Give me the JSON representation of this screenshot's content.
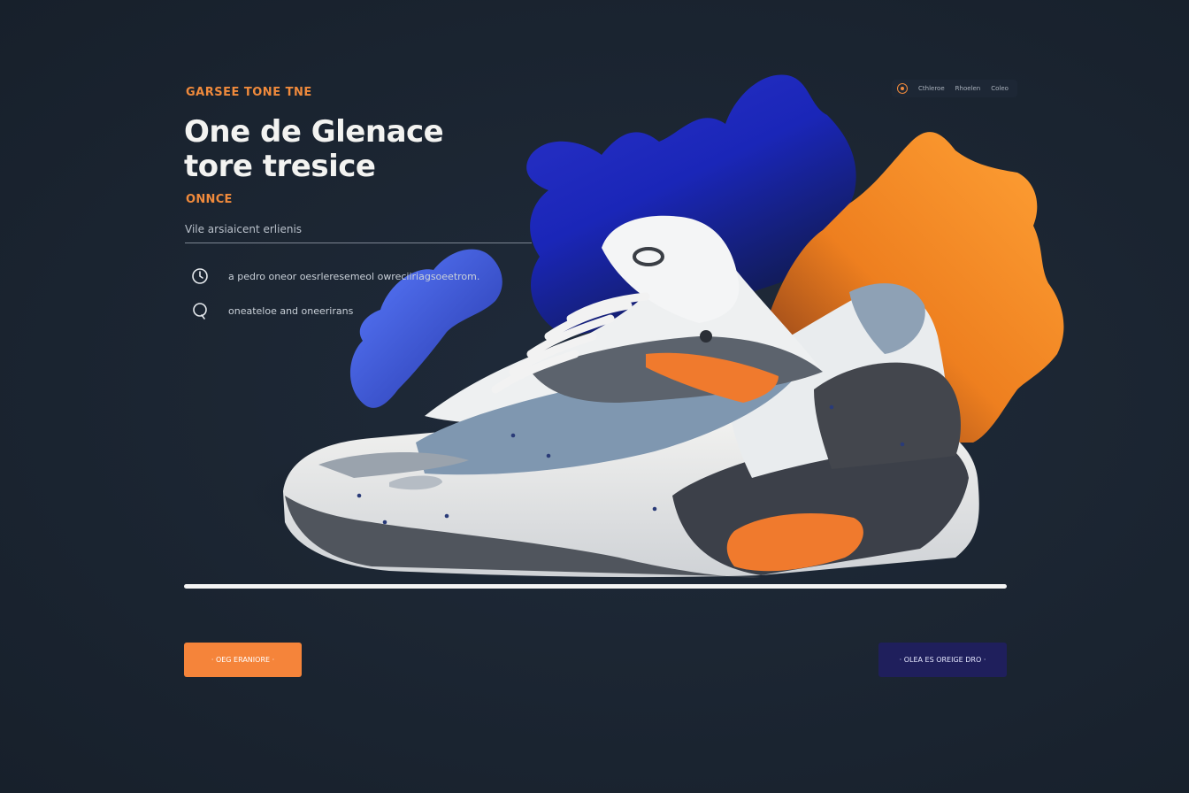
{
  "header": {
    "eyebrow": "GARSEE TONE TNE",
    "headline_line1": "One de Glenace",
    "headline_line2": "tore tresice",
    "tagline": "ONNCE"
  },
  "search": {
    "placeholder": "Vile arsiaicent erlienis"
  },
  "features": [
    {
      "icon": "clock-icon",
      "text": "a pedro oneor oesrleresemeol owreciiriagsoeetrom."
    },
    {
      "icon": "chat-bubble-icon",
      "text": "oneateloe and oneerirans"
    }
  ],
  "nav": {
    "items": [
      "Cthleroe",
      "Rhoelen",
      "Coleo"
    ]
  },
  "product": {
    "image": "sneaker-product-image"
  },
  "buttons": {
    "primary_label": "· OEG ERANIORE ·",
    "secondary_label": "· OLEA ES OREIGE DRO ·"
  },
  "colors": {
    "accent_orange": "#f5843a",
    "accent_blue": "#2130d6",
    "navy_button": "#1f1f5c",
    "background": "#1c2633"
  }
}
